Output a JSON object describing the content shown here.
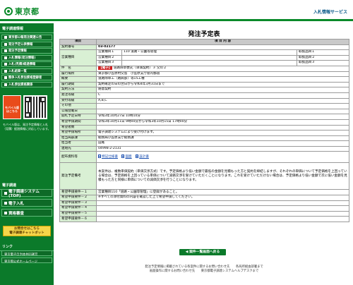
{
  "header": {
    "logo_text": "東京都",
    "system_title": "入札情報サービス"
  },
  "sidebar": {
    "section1": "電子調達情報",
    "items": [
      {
        "label": "東京都公報発注関連公告"
      },
      {
        "label": "発注予定公表情報"
      },
      {
        "label": "発注予定情報"
      },
      {
        "label": "入札情報(発注情報)"
      },
      {
        "label": "入札(見積)経過情報"
      },
      {
        "label": "入札結果一覧"
      },
      {
        "label": "競争入札参加資格登録者"
      },
      {
        "label": "入札参加資格関係"
      }
    ],
    "mobile_button": "モバイル版 はこちら",
    "mobile_note": "モバイル版は、発注予定情報と入札（見積）経過情報に対応しています。",
    "section2": "電子調達",
    "big_items": [
      {
        "label": "電子調達システム(TOP)"
      },
      {
        "label": "電子入札"
      },
      {
        "label": "資格審査"
      }
    ],
    "help_box": "お問合せはこちら\n電子調達チャットボット",
    "section3": "リンク",
    "links": [
      {
        "label": "東京電子自治体共同運営"
      },
      {
        "label": "東京都公式ホームページ"
      }
    ]
  },
  "main": {
    "page_title": "発注予定表",
    "col_item": "項目",
    "col_content": "項 目 内 容",
    "contract_no_label": "契約番号",
    "contract_no": "03-02177",
    "business_type_label": "営業種目",
    "business_rows": [
      {
        "name": "営業種目１",
        "value": "110 道路・公園等管理",
        "extra": "取扱品目１"
      },
      {
        "name": "営業種目２",
        "value": "",
        "extra": "取扱品目２"
      },
      {
        "name": "営業種目３",
        "value": "",
        "extra": "取扱品目３"
      }
    ],
    "rows": [
      {
        "label": "件　名",
        "badge": "【電子】",
        "value": "道路除草委託（単価契約）３ 父の２"
      },
      {
        "label": "履行場所",
        "value": "東京都小笠原村父島　小笠原支庁管内都道"
      },
      {
        "label": "概要",
        "value": "道路除草工（路肩部）等15工種"
      },
      {
        "label": "履行期間",
        "value": "契約確定の日の翌日から令和4年3月31日まで"
      },
      {
        "label": "契約方法",
        "value": "随意契約"
      },
      {
        "label": "発注等級",
        "value": "C"
      },
      {
        "label": "受付等級",
        "value": "A,B,C"
      },
      {
        "label": "その他",
        "value": ""
      },
      {
        "label": "公報登載日",
        "value": ""
      },
      {
        "label": "開札予定日時",
        "value": "令和3年10月27日 10時10分"
      },
      {
        "label": "希望申請期間",
        "value": "令和3年10月11日 9時00分から令和3年10月15日 17時00分"
      },
      {
        "label": "希望者数",
        "value": ""
      },
      {
        "label": "希望申請場所",
        "value": "電子調達システムにより受け付けます。"
      },
      {
        "label": "担当局部課",
        "value": "総務局小笠原支庁総務課"
      },
      {
        "label": "担当者",
        "value": "田尾"
      },
      {
        "label": "連絡先",
        "value": "04998-2-2131"
      }
    ],
    "docs_label": "配布資料等",
    "docs": [
      {
        "label": "特記仕様書"
      },
      {
        "label": "図面"
      },
      {
        "label": "設計書"
      }
    ],
    "notes_label": "発注予定備考",
    "notes_text": "本案件は、複数単価契約（単価交渉方式）です。予定価格より低い金額で最低の金額を見積もった方と契約を締結しますが、それぞれの単価について予定価格を上回っている場合は、予定価格を上回っている単価について減価交渉を受けていただくことになります。これを受けていただけない場合は、予定価格より低い金額で次に低い金額を見積もった方と同様に単価についての減価交渉を行うことになります。",
    "reqs": [
      {
        "label": "希望申請要件－１",
        "value": "営業種目110「道路・公園等管理」に登録があること。"
      },
      {
        "label": "希望申請要件－２",
        "value": "※すべての添付資料の内容を確認した上で希望申請してください。"
      },
      {
        "label": "希望申請要件－３",
        "value": ""
      },
      {
        "label": "希望申請要件－４",
        "value": ""
      },
      {
        "label": "希望申請要件－５",
        "value": ""
      },
      {
        "label": "希望申請要件－６",
        "value": ""
      }
    ],
    "back_button": "案件一覧画面へ戻る"
  },
  "footer": {
    "line1": "発注予定情報に掲載されている各案件に関するお問い合わせ先　　各局所総由部署まで",
    "line2": "画面操作に関するお問い合わせ先　　東京都電子調達システムヘルプデスクまで"
  }
}
